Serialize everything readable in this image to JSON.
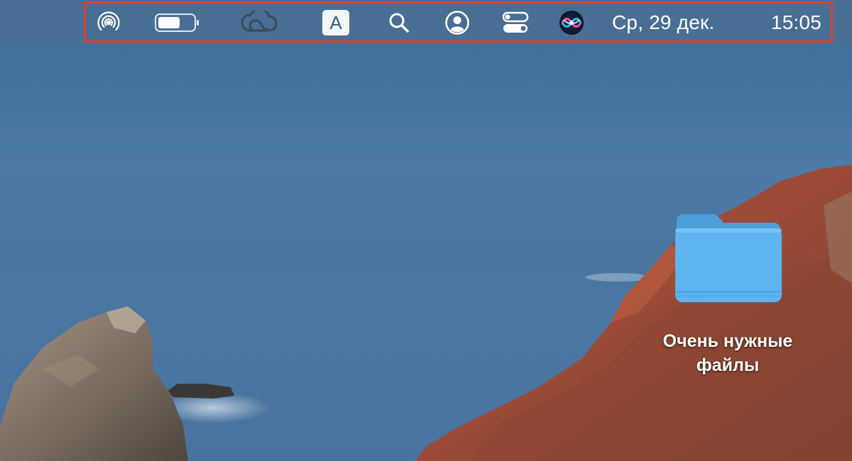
{
  "menubar": {
    "items": [
      {
        "id": "airdrop",
        "icon": "airdrop-icon"
      },
      {
        "id": "battery",
        "icon": "battery-icon"
      },
      {
        "id": "creative-cloud",
        "icon": "creative-cloud-icon"
      },
      {
        "id": "input-source",
        "icon": "input-source-icon",
        "label": "A"
      },
      {
        "id": "spotlight",
        "icon": "search-icon"
      },
      {
        "id": "user",
        "icon": "user-account-icon"
      },
      {
        "id": "control-center",
        "icon": "control-center-icon"
      },
      {
        "id": "siri",
        "icon": "siri-icon"
      }
    ],
    "date": "Ср, 29 дек.",
    "time": "15:05",
    "highlight_color": "#e53935"
  },
  "desktop": {
    "folder": {
      "icon": "folder-icon",
      "label": "Очень нужные файлы",
      "color": "#5db4ef"
    }
  }
}
